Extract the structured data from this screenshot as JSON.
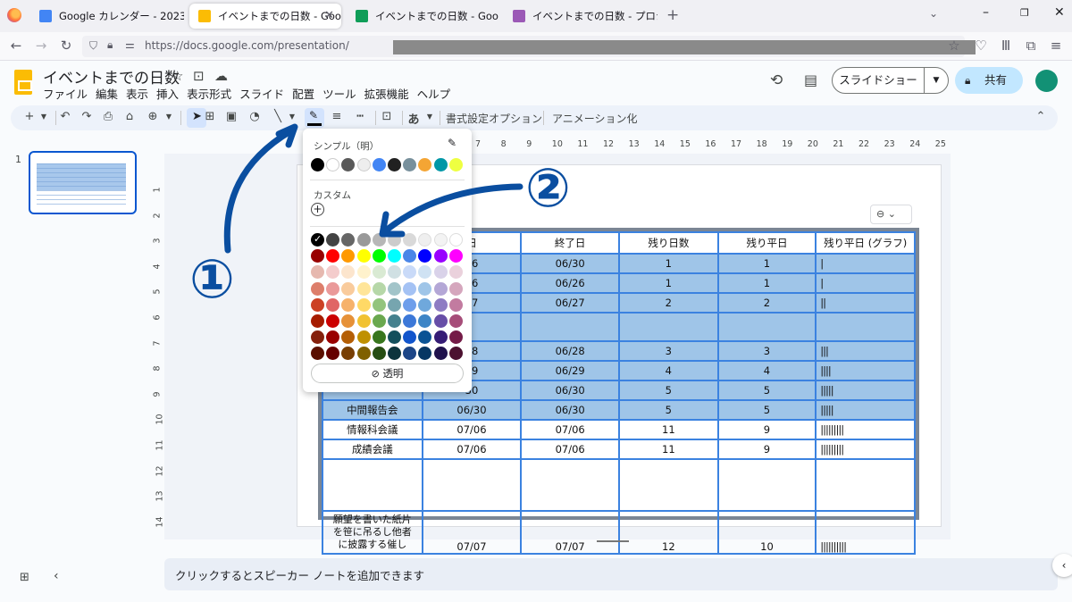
{
  "browser": {
    "tabs": [
      {
        "title": "Google カレンダー - 2023年 6月 2",
        "icon_color": "#4285f4",
        "active": false
      },
      {
        "title": "イベントまでの日数 - Google スライ",
        "icon_color": "#fbbc04",
        "active": true
      },
      {
        "title": "イベントまでの日数 - Google スプレ",
        "icon_color": "#0f9d58",
        "active": false
      },
      {
        "title": "イベントまでの日数 - プロジェクト編",
        "icon_color": "#9b59b6",
        "active": false
      }
    ],
    "new_tab": "+",
    "url": "https://docs.google.com/presentation/"
  },
  "doc": {
    "title": "イベントまでの日数",
    "menu": [
      "ファイル",
      "編集",
      "表示",
      "挿入",
      "表示形式",
      "スライド",
      "配置",
      "ツール",
      "拡張機能",
      "ヘルプ"
    ],
    "slideshow_label": "スライドショー",
    "share_label": "共有"
  },
  "toolbar": {
    "format_options": "書式設定オプション",
    "animation": "アニメーション化",
    "text_style": "あ"
  },
  "filmstrip": {
    "slide_number": "1"
  },
  "ruler": {
    "h": [
      "7",
      "8",
      "9",
      "10",
      "11",
      "12",
      "13",
      "14",
      "15",
      "16",
      "17",
      "18",
      "19",
      "20",
      "21",
      "22",
      "23",
      "24",
      "25"
    ],
    "v": [
      "1",
      "2",
      "3",
      "4",
      "5",
      "6",
      "7",
      "8",
      "9",
      "10",
      "11",
      "12",
      "13",
      "14"
    ]
  },
  "table": {
    "header": [
      "日",
      "終了日",
      "残り日数",
      "残り平日",
      "残り平日 (グラフ)"
    ],
    "rows": [
      {
        "c": [
          "",
          "26",
          "06/30",
          "1",
          "1",
          "|"
        ],
        "sel": true
      },
      {
        "c": [
          "",
          "26",
          "06/26",
          "1",
          "1",
          "|"
        ],
        "sel": true
      },
      {
        "c": [
          "",
          "27",
          "06/27",
          "2",
          "2",
          "||"
        ],
        "sel": true
      },
      {
        "c": [
          "",
          "",
          "",
          "",
          "",
          ""
        ],
        "sel": true
      },
      {
        "c": [
          "",
          "28",
          "06/28",
          "3",
          "3",
          "|||"
        ],
        "sel": true
      },
      {
        "c": [
          "",
          "29",
          "06/29",
          "4",
          "4",
          "||||"
        ],
        "sel": true
      },
      {
        "c": [
          "",
          "30",
          "06/30",
          "5",
          "5",
          "|||||"
        ],
        "sel": true
      },
      {
        "c": [
          "中間報告会",
          "06/30",
          "06/30",
          "5",
          "5",
          "|||||"
        ],
        "sel": true
      },
      {
        "c": [
          "情報科会議",
          "07/06",
          "07/06",
          "11",
          "9",
          "|||||||||"
        ],
        "sel": false
      },
      {
        "c": [
          "成績会議",
          "07/06",
          "07/06",
          "11",
          "9",
          "|||||||||"
        ],
        "sel": false
      },
      {
        "c": [
          "",
          "",
          "",
          "",
          "",
          ""
        ],
        "sel": false
      },
      {
        "c": [
          "願望を書いた紙片を笹に吊るし他者に披露する催し",
          "07/07",
          "07/07",
          "12",
          "10",
          "||||||||||"
        ],
        "sel": false
      }
    ]
  },
  "color_popup": {
    "simple_title": "シンプル（明）",
    "custom_title": "カスタム",
    "add_custom": "+",
    "transparent_label": "透明",
    "simple_colors": [
      "#000000",
      "#ffffff",
      "#595959",
      "#eeeeee",
      "#4285f4",
      "#212121",
      "#78909c",
      "#f4a534",
      "#0097a7",
      "#eeff41"
    ],
    "palette": [
      [
        "#000000",
        "#434343",
        "#666666",
        "#999999",
        "#b7b7b7",
        "#cccccc",
        "#d9d9d9",
        "#efefef",
        "#f3f3f3",
        "#ffffff"
      ],
      [
        "#980000",
        "#ff0000",
        "#ff9900",
        "#ffff00",
        "#00ff00",
        "#00ffff",
        "#4a86e8",
        "#0000ff",
        "#9900ff",
        "#ff00ff"
      ],
      [
        "#e6b8af",
        "#f4cccc",
        "#fce5cd",
        "#fff2cc",
        "#d9ead3",
        "#d0e0e3",
        "#c9daf8",
        "#cfe2f3",
        "#d9d2e9",
        "#ead1dc"
      ],
      [
        "#dd7e6b",
        "#ea9999",
        "#f9cb9c",
        "#ffe599",
        "#b6d7a8",
        "#a2c4c9",
        "#a4c2f4",
        "#9fc5e8",
        "#b4a7d6",
        "#d5a6bd"
      ],
      [
        "#cc4125",
        "#e06666",
        "#f6b26b",
        "#ffd966",
        "#93c47d",
        "#76a5af",
        "#6d9eeb",
        "#6fa8dc",
        "#8e7cc3",
        "#c27ba0"
      ],
      [
        "#a61c00",
        "#cc0000",
        "#e69138",
        "#f1c232",
        "#6aa84f",
        "#45818e",
        "#3c78d8",
        "#3d85c6",
        "#674ea7",
        "#a64d79"
      ],
      [
        "#85200c",
        "#990000",
        "#b45f06",
        "#bf9000",
        "#38761d",
        "#134f5c",
        "#1155cc",
        "#0b5394",
        "#351c75",
        "#741b47"
      ],
      [
        "#5b0f00",
        "#660000",
        "#783f04",
        "#7f6000",
        "#274e13",
        "#0c343d",
        "#1c4587",
        "#073763",
        "#20124d",
        "#4c1130"
      ]
    ],
    "selected_check": "✓"
  },
  "annotations": {
    "one": "①",
    "two": "②",
    "color": "#0a4ea0"
  },
  "notes": {
    "placeholder": "クリックするとスピーカー ノートを追加できます"
  }
}
